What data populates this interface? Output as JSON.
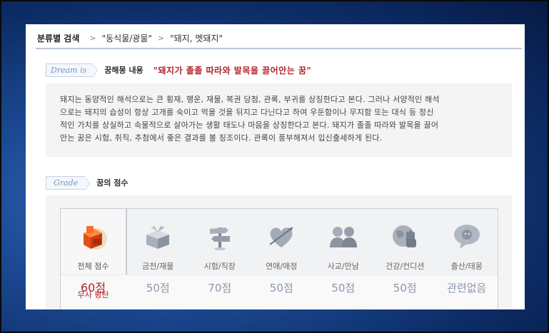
{
  "breadcrumb": {
    "root": "분류별 검색",
    "items": [
      "\"동식물/광물\"",
      "\"돼지, 멧돼지\""
    ]
  },
  "dream": {
    "tag": "Dream is",
    "label": "꿈해몽 내용",
    "title": "\"돼지가 졸졸 따라와 발목을 끌어안는 꿈\"",
    "lines": [
      "돼지는 동양적인 해석으로는 큰 횡재, 행운, 재물, 복권 당첨, 관록, 부귀를 상징한다고 본다. 그러나 서양적인 해석",
      "으로는 돼지의 습성이 항상 고개를 숙이고 먹을 것을 뒤지고 다닌다고 하여 우둔함이나 무지함 또는 대식 등 정신",
      "적인 가치를 상실하고 속물적으로 살아가는 생활 태도나 마음을 상징한다고 본다. 돼지가 졸졸 따라와 발목을 끌어",
      "안는 꿈은 시험, 취직, 추첨에서 좋은 결과를 볼 징조이다. 관록이 풍부해져서 입신출세하게 된다."
    ]
  },
  "grade": {
    "tag": "Grade",
    "label": "꿈의 점수",
    "total": {
      "label": "전체 점수",
      "score": "60점",
      "desc": "무사 평탄",
      "icon": "blocks-icon"
    },
    "categories": [
      {
        "label": "금전/재물",
        "score": "50점",
        "icon": "giftbox-icon"
      },
      {
        "label": "시험/직장",
        "score": "70점",
        "icon": "signpost-icon"
      },
      {
        "label": "연애/애정",
        "score": "50점",
        "icon": "heart-arrow-icon"
      },
      {
        "label": "사교/만남",
        "score": "50점",
        "icon": "people-icon"
      },
      {
        "label": "건강/컨디션",
        "score": "50점",
        "icon": "globe-hand-icon"
      },
      {
        "label": "출산/태몽",
        "score": "관련없음",
        "icon": "baby-bubble-icon"
      }
    ]
  },
  "colors": {
    "accent": "#b2232a",
    "score_gray": "#8a97aa",
    "tag_blue": "#7a95c0"
  }
}
